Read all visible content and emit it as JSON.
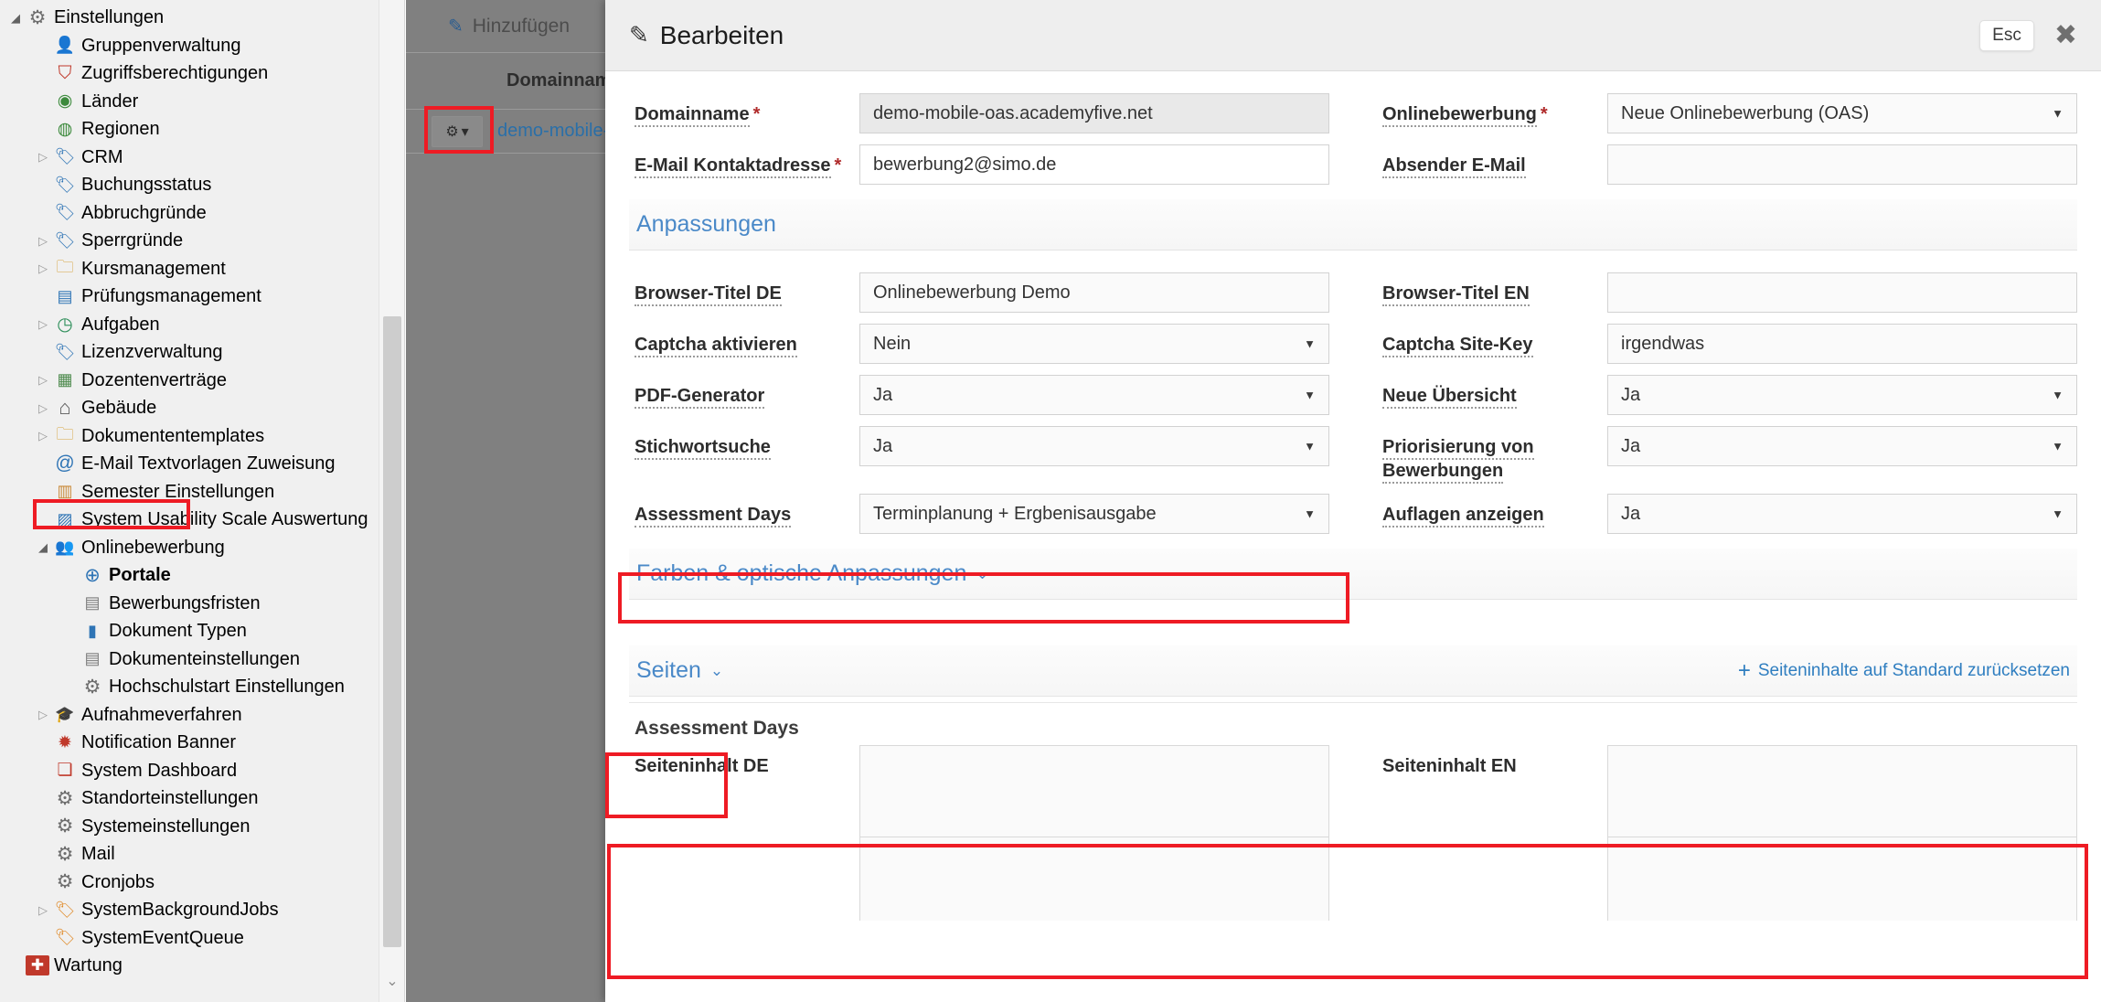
{
  "sidebar": {
    "items": [
      {
        "label": "Einstellungen",
        "level": 0,
        "icon": "gear-icon",
        "twist": "open",
        "bold": false
      },
      {
        "label": "Gruppenverwaltung",
        "level": 1,
        "icon": "user-icon",
        "twist": "",
        "bold": false
      },
      {
        "label": "Zugriffsberechtigungen",
        "level": 1,
        "icon": "shield-icon",
        "twist": "",
        "bold": false
      },
      {
        "label": "Länder",
        "level": 1,
        "icon": "globe-icon",
        "twist": "",
        "bold": false
      },
      {
        "label": "Regionen",
        "level": 1,
        "icon": "globe-region-icon",
        "twist": "",
        "bold": false
      },
      {
        "label": "CRM",
        "level": 1,
        "icon": "tag-icon",
        "twist": "closed",
        "bold": false
      },
      {
        "label": "Buchungsstatus",
        "level": 1,
        "icon": "tag-icon",
        "twist": "",
        "bold": false
      },
      {
        "label": "Abbruchgründe",
        "level": 1,
        "icon": "tag-icon",
        "twist": "",
        "bold": false
      },
      {
        "label": "Sperrgründe",
        "level": 1,
        "icon": "tag-icon",
        "twist": "closed",
        "bold": false
      },
      {
        "label": "Kursmanagement",
        "level": 1,
        "icon": "folder-icon",
        "twist": "closed",
        "bold": false
      },
      {
        "label": "Prüfungsmanagement",
        "level": 1,
        "icon": "chart-doc-icon",
        "twist": "",
        "bold": false
      },
      {
        "label": "Aufgaben",
        "level": 1,
        "icon": "clock-icon",
        "twist": "closed",
        "bold": false
      },
      {
        "label": "Lizenzverwaltung",
        "level": 1,
        "icon": "tag-icon",
        "twist": "",
        "bold": false
      },
      {
        "label": "Dozentenverträge",
        "level": 1,
        "icon": "contract-icon",
        "twist": "closed",
        "bold": false
      },
      {
        "label": "Gebäude",
        "level": 1,
        "icon": "home-icon",
        "twist": "closed",
        "bold": false
      },
      {
        "label": "Dokumententemplates",
        "level": 1,
        "icon": "folder-icon",
        "twist": "closed",
        "bold": false
      },
      {
        "label": "E-Mail Textvorlagen Zuweisung",
        "level": 1,
        "icon": "at-icon",
        "twist": "",
        "bold": false
      },
      {
        "label": "Semester Einstellungen",
        "level": 1,
        "icon": "calendar-icon",
        "twist": "",
        "bold": false
      },
      {
        "label": "System Usability Scale Auswertung",
        "level": 1,
        "icon": "chart-icon",
        "twist": "",
        "bold": false
      },
      {
        "label": "Onlinebewerbung",
        "level": 1,
        "icon": "people-icon",
        "twist": "open",
        "bold": false
      },
      {
        "label": "Portale",
        "level": 2,
        "icon": "globe-blue-icon",
        "twist": "",
        "bold": true
      },
      {
        "label": "Bewerbungsfristen",
        "level": 2,
        "icon": "list-icon",
        "twist": "",
        "bold": false
      },
      {
        "label": "Dokument Typen",
        "level": 2,
        "icon": "book-icon",
        "twist": "",
        "bold": false
      },
      {
        "label": "Dokumenteinstellungen",
        "level": 2,
        "icon": "list-icon",
        "twist": "",
        "bold": false
      },
      {
        "label": "Hochschulstart Einstellungen",
        "level": 2,
        "icon": "gear-icon",
        "twist": "",
        "bold": false
      },
      {
        "label": "Aufnahmeverfahren",
        "level": 1,
        "icon": "graduation-icon",
        "twist": "closed",
        "bold": false
      },
      {
        "label": "Notification Banner",
        "level": 1,
        "icon": "bell-icon",
        "twist": "",
        "bold": false
      },
      {
        "label": "System Dashboard",
        "level": 1,
        "icon": "cubes-icon",
        "twist": "",
        "bold": false
      },
      {
        "label": "Standorteinstellungen",
        "level": 1,
        "icon": "gear-icon",
        "twist": "",
        "bold": false
      },
      {
        "label": "Systemeinstellungen",
        "level": 1,
        "icon": "gear-icon",
        "twist": "",
        "bold": false
      },
      {
        "label": "Mail",
        "level": 1,
        "icon": "gear-icon",
        "twist": "",
        "bold": false
      },
      {
        "label": "Cronjobs",
        "level": 1,
        "icon": "gear-icon",
        "twist": "",
        "bold": false
      },
      {
        "label": "SystemBackgroundJobs",
        "level": 1,
        "icon": "orange-tag-icon",
        "twist": "closed",
        "bold": false
      },
      {
        "label": "SystemEventQueue",
        "level": 1,
        "icon": "orange-tag-icon",
        "twist": "",
        "bold": false
      },
      {
        "label": "Wartung",
        "level": 0,
        "icon": "toolbox-icon",
        "twist": "",
        "bold": false
      }
    ]
  },
  "background": {
    "toolbar_add_label": "Hinzufügen",
    "table_header": "Domainname",
    "row_link": "demo-mobile-"
  },
  "panel": {
    "title": "Bearbeiten",
    "esc_label": "Esc",
    "close_label": "✖",
    "top_fields": [
      {
        "label": "Domainname",
        "required": true,
        "value": "demo-mobile-oas.academyfive.net",
        "type": "text",
        "state": "disabled",
        "right_label": "Onlinebewerbung",
        "right_required": true,
        "right_value": "Neue Onlinebewerbung (OAS)",
        "right_type": "select",
        "right_state": "normal"
      },
      {
        "label": "E-Mail Kontaktadresse",
        "required": true,
        "value": "bewerbung2@simo.de",
        "type": "text",
        "state": "white",
        "right_label": "Absender E-Mail",
        "right_required": false,
        "right_value": "",
        "right_type": "text",
        "right_state": "normal"
      }
    ],
    "anpassungen": {
      "section_title": "Anpassungen",
      "rows": [
        {
          "label": "Browser-Titel DE",
          "value": "Onlinebewerbung Demo",
          "type": "text",
          "state": "normal",
          "right_label": "Browser-Titel EN",
          "right_value": "",
          "right_type": "text",
          "right_state": "normal"
        },
        {
          "label": "Captcha aktivieren",
          "value": "Nein",
          "type": "select",
          "state": "normal",
          "right_label": "Captcha Site-Key",
          "right_value": "irgendwas",
          "right_type": "text",
          "right_state": "normal"
        },
        {
          "label": "PDF-Generator",
          "value": "Ja",
          "type": "select",
          "state": "normal",
          "right_label": "Neue Übersicht",
          "right_value": "Ja",
          "right_type": "select",
          "right_state": "normal"
        },
        {
          "label": "Stichwortsuche",
          "value": "Ja",
          "type": "select",
          "state": "normal",
          "right_label": "Priorisierung von Bewerbungen",
          "right_value": "Ja",
          "right_type": "select",
          "right_state": "normal"
        },
        {
          "label": "Assessment Days",
          "value": "Terminplanung + Ergbenisausgabe",
          "type": "select",
          "state": "normal",
          "right_label": "Auflagen anzeigen",
          "right_value": "Ja",
          "right_type": "select",
          "right_state": "normal"
        }
      ]
    },
    "farben_section": {
      "title": "Farben & optische Anpassungen",
      "chevron": "⌄"
    },
    "seiten_section": {
      "title": "Seiten",
      "chevron": "⌄",
      "reset_link": "Seiteninhalte auf Standard zurücksetzen",
      "reset_plus": "+"
    },
    "pages": {
      "group_title": "Assessment Days",
      "label_de": "Seiteninhalt DE",
      "label_en": "Seiteninhalt EN",
      "value_de": "",
      "value_en": ""
    }
  },
  "colors": {
    "accent_blue": "#4a89c8",
    "link_blue": "#2f7ec0",
    "highlight_red": "#ee1b24",
    "required_red": "#b02b2b",
    "overlay_grey": "#808080"
  }
}
